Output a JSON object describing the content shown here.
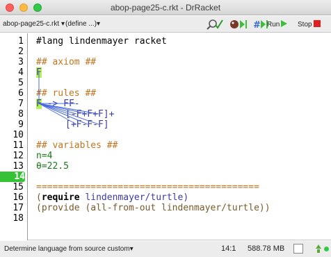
{
  "window": {
    "title": "abop-page25-c.rkt - DrRacket"
  },
  "toolbar": {
    "file_menu": "abop-page25-c.rkt",
    "define_menu": "(define ...)",
    "run_label": "Run",
    "stop_label": "Stop",
    "colors": {
      "run": "#3cc03c",
      "stop": "#e02020"
    }
  },
  "editor": {
    "active_line": "14",
    "lines": [
      {
        "n": "1",
        "text": "#lang lindenmayer racket"
      },
      {
        "n": "2",
        "text": ""
      },
      {
        "n": "3",
        "text": "## axiom ##"
      },
      {
        "n": "4",
        "text": "F"
      },
      {
        "n": "5",
        "text": ""
      },
      {
        "n": "6",
        "text": "## rules ##"
      },
      {
        "n": "7",
        "a": "F",
        "b": " -> ",
        "c": "FF-"
      },
      {
        "n": "8",
        "text": "[-F+F+F]+"
      },
      {
        "n": "9",
        "text": "[+F-F-F]"
      },
      {
        "n": "10",
        "text": ""
      },
      {
        "n": "11",
        "text": "## variables ##"
      },
      {
        "n": "12",
        "text": "n=4"
      },
      {
        "n": "13",
        "text": "θ=22.5"
      },
      {
        "n": "14",
        "text": ""
      },
      {
        "n": "15",
        "text": "========================================="
      },
      {
        "n": "16",
        "a": "(",
        "b": "require",
        "c": " lindenmayer/turtle)"
      },
      {
        "n": "17",
        "text": "(provide (all-from-out lindenmayer/turtle))"
      },
      {
        "n": "18",
        "text": ""
      }
    ]
  },
  "statusbar": {
    "language": "Determine language from source custom",
    "position": "14:1",
    "memory": "588.78 MB"
  }
}
